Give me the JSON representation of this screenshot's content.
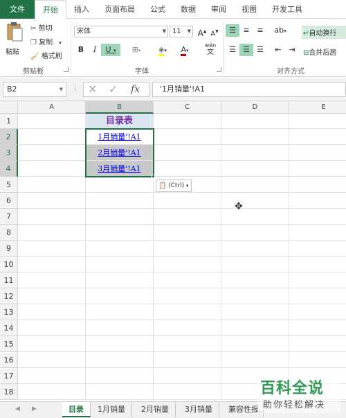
{
  "ribbon_tabs": [
    "文件",
    "开始",
    "插入",
    "页面布局",
    "公式",
    "数据",
    "审阅",
    "视图",
    "开发工具"
  ],
  "active_tab": "开始",
  "clipboard": {
    "paste": "粘贴",
    "cut": "剪切",
    "copy": "复制",
    "format_painter": "格式刷",
    "group_label": "剪贴板"
  },
  "font": {
    "name": "宋体",
    "size": "11",
    "grow": "A",
    "shrink": "A",
    "bold": "B",
    "italic": "I",
    "underline": "U",
    "font_color": "A",
    "phonetic": "wén",
    "group_label": "字体"
  },
  "alignment": {
    "wrap_text": "自动换行",
    "merge_center": "合并后居",
    "group_label": "对齐方式"
  },
  "formula_bar": {
    "name_box": "B2",
    "fx": "fx",
    "content": "'1月销量'!A1"
  },
  "columns": [
    "A",
    "B",
    "C",
    "D",
    "E"
  ],
  "rows": [
    "1",
    "2",
    "3",
    "4",
    "5",
    "6",
    "7",
    "8",
    "9",
    "10",
    "11",
    "12",
    "13",
    "14",
    "15",
    "16",
    "17",
    "18"
  ],
  "table": {
    "title": "目录表",
    "links": [
      "1月销量'!A1",
      "2月销量'!A1",
      "3月销量'!A1"
    ]
  },
  "paste_options": "(Ctrl)",
  "sheets": [
    "目录",
    "1月销量",
    "2月销量",
    "3月销量",
    "兼容性报..."
  ],
  "active_sheet": "目录",
  "watermark": {
    "title": "百科全说",
    "subtitle": "助你轻松解决"
  },
  "colors": {
    "excel_green": "#217346",
    "title_purple": "#7030a0",
    "title_fill": "#dce6f1",
    "link_blue": "#0000ee",
    "watermark_green": "#2e9a52"
  }
}
